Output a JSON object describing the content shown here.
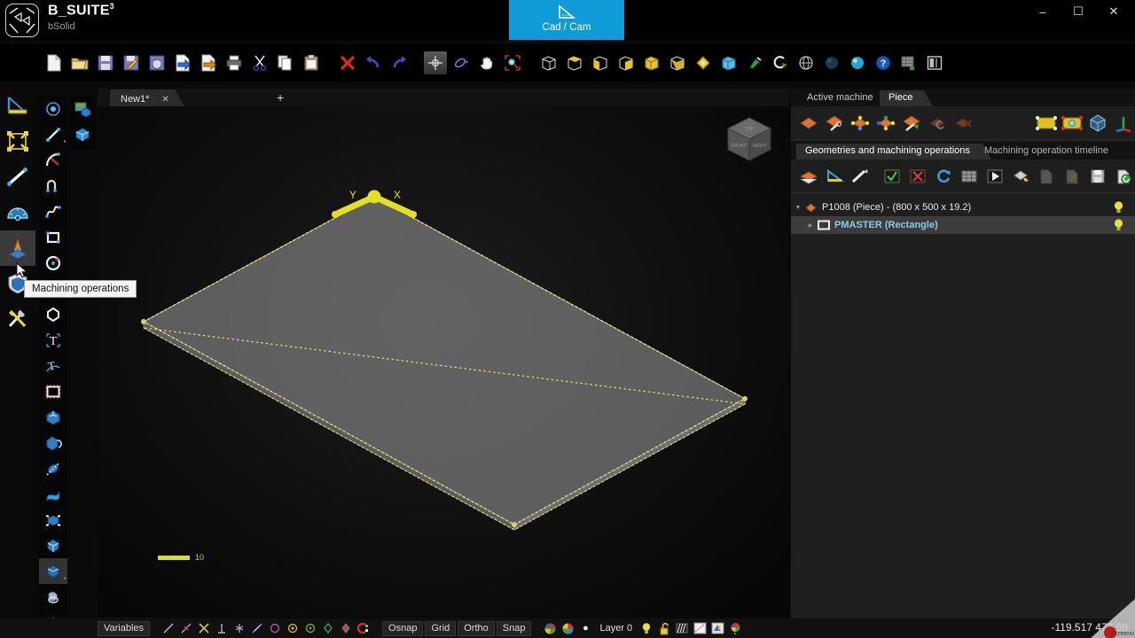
{
  "app": {
    "brand_name": "B_SUITE",
    "brand_sup": "3",
    "brand_sub": "bSolid",
    "logo_icon": "bsuite-logo-icon"
  },
  "window_controls": {
    "minimize": "–",
    "maximize": "☐",
    "close": "✕"
  },
  "ribbon_tab": {
    "label": "Cad / Cam",
    "icon": "set-square-icon",
    "accent_color": "#0f9bd7"
  },
  "main_toolbar": {
    "items": [
      {
        "name": "new-file-icon",
        "tip": "New"
      },
      {
        "name": "open-folder-icon",
        "tip": "Open"
      },
      {
        "name": "save-icon",
        "tip": "Save"
      },
      {
        "name": "save-as-icon",
        "tip": "Save as"
      },
      {
        "name": "save-protected-icon",
        "tip": "Save protected"
      },
      {
        "name": "import-icon",
        "tip": "Import"
      },
      {
        "name": "export-icon",
        "tip": "Export"
      },
      {
        "name": "print-icon",
        "tip": "Print"
      },
      {
        "name": "cut-scissors-icon",
        "tip": "Cut"
      },
      {
        "name": "copy-icon",
        "tip": "Copy"
      },
      {
        "name": "paste-clipboard-icon",
        "tip": "Paste"
      },
      {
        "name": "delete-x-icon",
        "tip": "Delete"
      },
      {
        "name": "undo-icon",
        "tip": "Undo"
      },
      {
        "name": "redo-icon",
        "tip": "Redo"
      },
      {
        "name": "move-crosshair-icon",
        "tip": "Move"
      },
      {
        "name": "rotate-3d-icon",
        "tip": "Rotate view"
      },
      {
        "name": "pan-hand-icon",
        "tip": "Pan"
      },
      {
        "name": "zoom-window-icon",
        "tip": "Zoom window"
      },
      {
        "name": "view-box-wire-icon",
        "tip": "Wireframe view"
      },
      {
        "name": "view-box-top-icon",
        "tip": "Top view"
      },
      {
        "name": "view-box-front-icon",
        "tip": "Front view"
      },
      {
        "name": "view-box-side-icon",
        "tip": "Side view"
      },
      {
        "name": "view-box-iso-icon",
        "tip": "Isometric view"
      },
      {
        "name": "view-box-shaded-icon",
        "tip": "Shaded view"
      },
      {
        "name": "view-diamond-icon",
        "tip": "Custom view"
      },
      {
        "name": "view-cube-blue-icon",
        "tip": "Solid view"
      },
      {
        "name": "pin-view-icon",
        "tip": "Pin view"
      },
      {
        "name": "rotate-arrow-icon",
        "tip": "Rotate"
      },
      {
        "name": "globe-wire-icon",
        "tip": "Global view"
      },
      {
        "name": "sphere-dark-icon",
        "tip": "Render dark"
      },
      {
        "name": "sphere-light-icon",
        "tip": "Render light"
      },
      {
        "name": "help-icon",
        "tip": "Help"
      },
      {
        "name": "grid-export-icon",
        "tip": "Report"
      },
      {
        "name": "split-panel-icon",
        "tip": "Split view"
      }
    ]
  },
  "left_toolbar_outer": {
    "items": [
      {
        "name": "set-square-ruler-icon",
        "tip": "Drawing tools",
        "active": false
      },
      {
        "name": "resize-frame-icon",
        "tip": "Resize",
        "active": false
      },
      {
        "name": "measure-distance-icon",
        "tip": "Measure distance",
        "active": false
      },
      {
        "name": "protractor-icon",
        "tip": "Measure angle",
        "active": false
      },
      {
        "name": "machining-operations-icon",
        "tip": "Machining operations",
        "active": true
      },
      {
        "name": "shield-blue-icon",
        "tip": "Protections",
        "active": false
      },
      {
        "name": "tools-wrench-icon",
        "tip": "Utilities",
        "active": false
      }
    ]
  },
  "left_toolbar_inner": {
    "items": [
      {
        "name": "point-icon",
        "tip": "Point"
      },
      {
        "name": "line-icon",
        "tip": "Line"
      },
      {
        "name": "arc-icon",
        "tip": "Arc"
      },
      {
        "name": "polyline-icon",
        "tip": "Polyline"
      },
      {
        "name": "spline-icon",
        "tip": "Spline"
      },
      {
        "name": "rectangle-icon",
        "tip": "Rectangle"
      },
      {
        "name": "circle-icon",
        "tip": "Circle"
      },
      {
        "name": "ellipse-icon",
        "tip": "Ellipse"
      },
      {
        "name": "polygon-icon",
        "tip": "Polygon"
      },
      {
        "name": "text-icon",
        "tip": "Text"
      },
      {
        "name": "curved-text-icon",
        "tip": "Text on curve"
      },
      {
        "name": "selection-frame-icon",
        "tip": "Selection"
      },
      {
        "name": "extrude-solid-icon",
        "tip": "Extrude"
      },
      {
        "name": "revolve-solid-icon",
        "tip": "Revolve"
      },
      {
        "name": "sweep-solid-icon",
        "tip": "Sweep"
      },
      {
        "name": "surface-solid-icon",
        "tip": "Surface"
      },
      {
        "name": "explode-solid-icon",
        "tip": "Explode"
      },
      {
        "name": "boolean-solid-icon",
        "tip": "Boolean"
      },
      {
        "name": "solid-block-icon",
        "tip": "Solid block"
      },
      {
        "name": "loft-solid-icon",
        "tip": "Loft"
      },
      {
        "name": "shell-solid-icon",
        "tip": "Shell"
      }
    ]
  },
  "left_toolbar_extra": {
    "items": [
      {
        "name": "layers-image-icon",
        "tip": "Layers"
      },
      {
        "name": "solid-blue-icon",
        "tip": "Solids"
      }
    ]
  },
  "doc_tabs": {
    "tabs": [
      {
        "label": "New1*",
        "close": "✕"
      }
    ],
    "add_label": "+"
  },
  "viewport": {
    "axis_x_label": "X",
    "axis_y_label": "Y",
    "scale_value": "10",
    "viewcube": {
      "top": "TOP",
      "front": "FRONT",
      "right": "RIGHT"
    }
  },
  "right_panel": {
    "tabs": [
      {
        "label": "Active machine",
        "selected": false
      },
      {
        "label": "Piece",
        "selected": true
      }
    ],
    "piece_tools": [
      {
        "name": "piece-plain-icon",
        "tip": "Piece"
      },
      {
        "name": "piece-edit-icon",
        "tip": "Edit piece"
      },
      {
        "name": "piece-points-icon",
        "tip": "Piece points"
      },
      {
        "name": "piece-origin-icon",
        "tip": "Piece origin"
      },
      {
        "name": "piece-face-icon",
        "tip": "Piece face"
      },
      {
        "name": "piece-undo-icon",
        "tip": "Undo piece"
      },
      {
        "name": "piece-delete-icon",
        "tip": "Delete piece"
      }
    ],
    "view_tools": [
      {
        "name": "piece-frame-icon",
        "tip": "Piece frame"
      },
      {
        "name": "piece-select-icon",
        "tip": "Select piece"
      },
      {
        "name": "piece-cube-icon",
        "tip": "3D piece"
      },
      {
        "name": "axis-rgb-icon",
        "tip": "Axes"
      }
    ],
    "sub_tabs": [
      {
        "label": "Geometries and machining operations",
        "selected": true
      },
      {
        "label": "Machining operation timeline",
        "selected": false
      }
    ],
    "tree_tools_left": [
      {
        "name": "layers-stack-icon",
        "tip": "Layers"
      },
      {
        "name": "geometry-triangle-icon",
        "tip": "Geometry"
      },
      {
        "name": "tool-pen-icon",
        "tip": "Tool"
      }
    ],
    "tree_tools_right": [
      {
        "name": "check-green-icon",
        "tip": "Enable"
      },
      {
        "name": "cross-red-icon",
        "tip": "Disable"
      },
      {
        "name": "refresh-blue-icon",
        "tip": "Refresh"
      },
      {
        "name": "table-grid-icon",
        "tip": "Table"
      },
      {
        "name": "play-icon",
        "tip": "Execute"
      },
      {
        "name": "add-operation-icon",
        "tip": "Add operation"
      },
      {
        "name": "page-gray-icon",
        "tip": "Page"
      },
      {
        "name": "edit-gray-icon",
        "tip": "Edit"
      },
      {
        "name": "save-disk-icon",
        "tip": "Save"
      },
      {
        "name": "apply-green-icon",
        "tip": "Apply"
      }
    ],
    "tree": [
      {
        "label": "P1008 (Piece) - (800 x 500 x 19.2)",
        "icon": "piece-diamond-icon",
        "level": 1,
        "selected": false,
        "twist": "▼",
        "bulb": "bulb-on-icon"
      },
      {
        "label": "PMASTER (Rectangle)",
        "icon": "rectangle-white-icon",
        "level": 2,
        "selected": true,
        "twist": "▶",
        "bulb": "bulb-on-icon"
      }
    ]
  },
  "tooltip": {
    "text": "Machining operations"
  },
  "status_bar": {
    "variables_label": "Variables",
    "snap_icons": [
      {
        "name": "snap-endpoint-icon"
      },
      {
        "name": "snap-midpoint-icon"
      },
      {
        "name": "snap-intersection-icon"
      },
      {
        "name": "snap-perpendicular-icon"
      },
      {
        "name": "snap-node-icon"
      },
      {
        "name": "snap-tangent-icon"
      },
      {
        "name": "snap-quadrant-icon"
      },
      {
        "name": "snap-center-icon"
      },
      {
        "name": "snap-circle-icon"
      },
      {
        "name": "snap-nearest-icon"
      },
      {
        "name": "snap-parallel-icon"
      },
      {
        "name": "snap-toggle-icon"
      }
    ],
    "toggles": [
      {
        "label": "Osnap"
      },
      {
        "label": "Grid"
      },
      {
        "label": "Ortho"
      },
      {
        "label": "Snap"
      }
    ],
    "layer_icons": [
      {
        "name": "color-palette-icon"
      },
      {
        "name": "color-wheel-icon"
      }
    ],
    "layer_label": "Layer 0",
    "layer_dot": "●",
    "layer_state_icons": [
      {
        "name": "bulb-on-icon"
      },
      {
        "name": "unlock-icon"
      },
      {
        "name": "hatch-icon"
      },
      {
        "name": "linetype-icon"
      },
      {
        "name": "lineweight-icon"
      },
      {
        "name": "color-layer-icon"
      }
    ],
    "coordinates": "-119.517  472.98"
  }
}
